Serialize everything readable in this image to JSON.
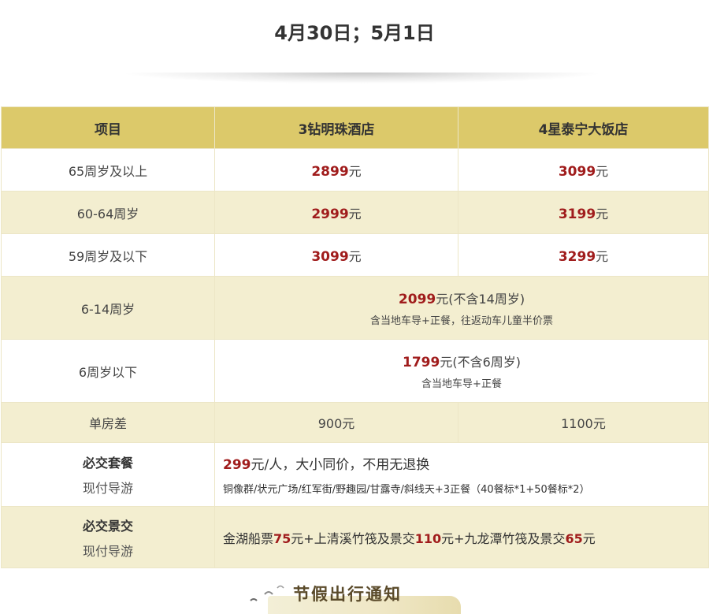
{
  "page": {
    "date_title": "4月30日；5月1日"
  },
  "table": {
    "headers": [
      "项目",
      "3钻明珠酒店",
      "4星泰宁大饭店"
    ],
    "rows": [
      {
        "label": "65周岁及以上",
        "a_price": "2899",
        "a_unit": "元",
        "b_price": "3099",
        "b_unit": "元"
      },
      {
        "label": "60-64周岁",
        "a_price": "2999",
        "a_unit": "元",
        "b_price": "3199",
        "b_unit": "元"
      },
      {
        "label": "59周岁及以下",
        "a_price": "3099",
        "a_unit": "元",
        "b_price": "3299",
        "b_unit": "元"
      }
    ],
    "child_rows": [
      {
        "label": "6-14周岁",
        "price": "2099",
        "suffix": "元(不含14周岁)",
        "note": "含当地车导+正餐，往返动车儿童半价票"
      },
      {
        "label": "6周岁以下",
        "price": "1799",
        "suffix": "元(不含6周岁)",
        "note": "含当地车导+正餐"
      }
    ],
    "single_room": {
      "label": "单房差",
      "a": "900元",
      "b": "1100元"
    },
    "package": {
      "label": "必交套餐",
      "sub": "现付导游",
      "price": "299",
      "text": "元/人，大小同价，不用无退换",
      "detail": "铜像群/状元广场/红军街/野趣园/甘露寺/斜线天+3正餐（40餐标*1+50餐标*2）"
    },
    "scenic": {
      "label": "必交景交",
      "sub": "现付导游",
      "part1": "金湖船票",
      "p1": "75",
      "part2": "元+上清溪竹筏及景交",
      "p2": "110",
      "part3": "元+九龙潭竹筏及景交",
      "p3": "65",
      "part4": "元"
    }
  },
  "footer": {
    "title": "节假出行通知",
    "icon": "bird-icon"
  },
  "colors": {
    "header_bg": "#dcc96a",
    "band_bg": "#f3eed0",
    "price_red": "#a01c1c"
  }
}
